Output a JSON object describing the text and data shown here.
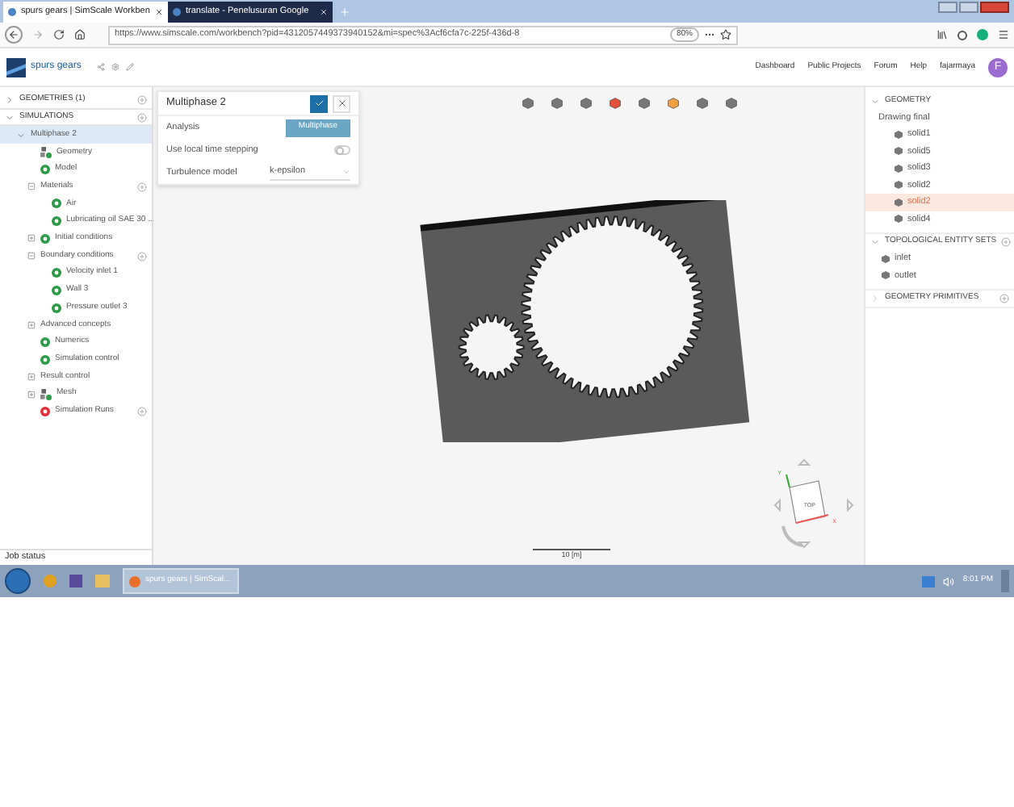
{
  "browser": {
    "tabs": [
      {
        "title": "spurs gears | SimScale Workben",
        "selected": true
      },
      {
        "title": "translate - Penelusuran Google",
        "selected": false
      }
    ],
    "url": "https://www.simscale.com/workbench?pid=4312057449373940152&mi=spec%3Acf6cfa7c-225f-436d-8",
    "zoom": "80%"
  },
  "app": {
    "project": "spurs gears",
    "nav": [
      "Dashboard",
      "Public Projects",
      "Forum",
      "Help"
    ],
    "user": "fajarmaya",
    "avatar": "F"
  },
  "tree": [
    {
      "label": "GEOMETRIES (1)",
      "kind": "section",
      "expanded": false,
      "add_button": true,
      "selected": false
    },
    {
      "label": "SIMULATIONS",
      "kind": "section",
      "expanded": true,
      "add_button": true,
      "selected": false,
      "children": [
        {
          "label": "Multiphase 2",
          "kind": "simulation",
          "expanded": true,
          "selected": true,
          "children": [
            {
              "label": "Geometry",
              "kind": "geometry",
              "selected": false
            },
            {
              "label": "Model",
              "kind": "ok",
              "selected": false
            },
            {
              "label": "Materials",
              "kind": "plain",
              "expanded": true,
              "add_button": true,
              "selected": false,
              "children": [
                {
                  "label": "Air",
                  "kind": "ok",
                  "selected": false
                },
                {
                  "label": "Lubricating oil SAE 30 ...",
                  "kind": "ok",
                  "selected": false
                }
              ]
            },
            {
              "label": "Initial conditions",
              "kind": "ok",
              "expanded": false,
              "selected": false
            },
            {
              "label": "Boundary conditions",
              "kind": "plain",
              "expanded": true,
              "add_button": true,
              "selected": false,
              "children": [
                {
                  "label": "Velocity inlet 1",
                  "kind": "ok",
                  "selected": false
                },
                {
                  "label": "Wall 3",
                  "kind": "ok",
                  "selected": false
                },
                {
                  "label": "Pressure outlet 3",
                  "kind": "ok",
                  "selected": false
                }
              ]
            },
            {
              "label": "Advanced concepts",
              "kind": "plain",
              "expanded": false,
              "selected": false
            },
            {
              "label": "Numerics",
              "kind": "ok",
              "selected": false
            },
            {
              "label": "Simulation control",
              "kind": "ok",
              "selected": false
            },
            {
              "label": "Result control",
              "kind": "plain",
              "expanded": false,
              "selected": false
            },
            {
              "label": "Mesh",
              "kind": "geometry",
              "expanded": false,
              "selected": false
            },
            {
              "label": "Simulation Runs",
              "kind": "error",
              "add_button": true,
              "selected": false
            }
          ]
        }
      ]
    }
  ],
  "job_status": "Job status",
  "panel": {
    "title": "Multiphase 2",
    "rows": [
      {
        "kind": "button",
        "label": "Analysis",
        "value": "Multiphase"
      },
      {
        "kind": "toggle",
        "label": "Use local time stepping",
        "on": false
      },
      {
        "kind": "select",
        "label": "Turbulence model",
        "value": "k-epsilon"
      }
    ]
  },
  "right_panel": {
    "sections": [
      {
        "title": "GEOMETRY",
        "expanded": true,
        "groups": [
          {
            "label": "Drawing final",
            "items": [
              {
                "label": "solid1",
                "selected": false
              },
              {
                "label": "solid5",
                "selected": false
              },
              {
                "label": "solid3",
                "selected": false
              },
              {
                "label": "solid2",
                "selected": false
              },
              {
                "label": "solid2",
                "selected": true
              },
              {
                "label": "solid4",
                "selected": false
              }
            ]
          }
        ]
      },
      {
        "title": "TOPOLOGICAL ENTITY SETS",
        "expanded": true,
        "add_button": true,
        "groups": [
          {
            "items": [
              {
                "label": "inlet",
                "selected": false
              },
              {
                "label": "outlet",
                "selected": false
              }
            ]
          }
        ]
      },
      {
        "title": "GEOMETRY PRIMITIVES",
        "expanded": false,
        "add_button": true
      }
    ]
  },
  "viewport": {
    "scale": "10 [m]",
    "cube_face": "TOP",
    "axis_x": "X",
    "axis_y": "Y"
  },
  "taskbar": {
    "window": "spurs gears | SimScal...",
    "time": "8:01 PM"
  }
}
